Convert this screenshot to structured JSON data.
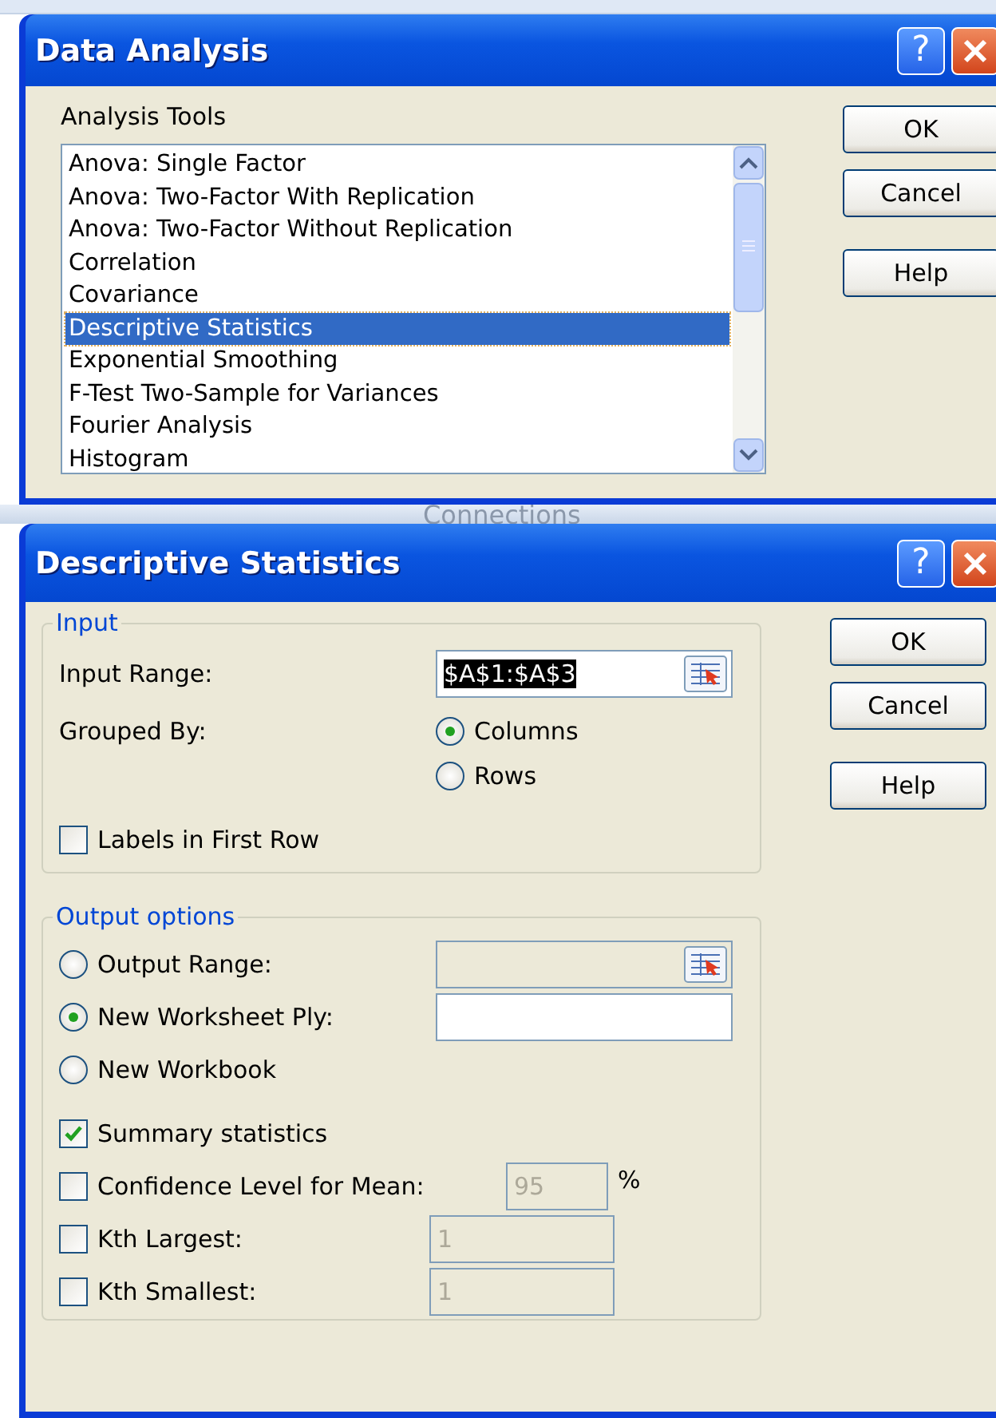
{
  "data_analysis": {
    "title": "Data Analysis",
    "help_glyph": "?",
    "list_label": "Analysis Tools",
    "tools": [
      {
        "label": "Anova: Single Factor",
        "selected": false
      },
      {
        "label": "Anova: Two-Factor With Replication",
        "selected": false
      },
      {
        "label": "Anova: Two-Factor Without Replication",
        "selected": false
      },
      {
        "label": "Correlation",
        "selected": false
      },
      {
        "label": "Covariance",
        "selected": false
      },
      {
        "label": "Descriptive Statistics",
        "selected": true
      },
      {
        "label": "Exponential Smoothing",
        "selected": false
      },
      {
        "label": "F-Test Two-Sample for Variances",
        "selected": false
      },
      {
        "label": "Fourier Analysis",
        "selected": false
      },
      {
        "label": "Histogram",
        "selected": false
      }
    ],
    "buttons": [
      "OK",
      "Cancel",
      "Help"
    ]
  },
  "background": {
    "toolbar_label": "Connections"
  },
  "descriptive_statistics": {
    "title": "Descriptive Statistics",
    "help_glyph": "?",
    "input": {
      "legend": "Input",
      "range_label": "Input Range:",
      "range_value": "$A$1:$A$3",
      "grouped_label": "Grouped By:",
      "grouped_options": [
        {
          "label": "Columns",
          "selected": true
        },
        {
          "label": "Rows",
          "selected": false
        }
      ],
      "labels_first_row": {
        "label": "Labels in First Row",
        "checked": false
      }
    },
    "output": {
      "legend": "Output options",
      "destinations": [
        {
          "label": "Output Range:",
          "selected": false,
          "kind": "range"
        },
        {
          "label": "New Worksheet Ply:",
          "selected": true,
          "kind": "text"
        },
        {
          "label": "New Workbook",
          "selected": false,
          "kind": "none"
        }
      ],
      "options": [
        {
          "label": "Summary statistics",
          "checked": true,
          "kind": "plain"
        },
        {
          "label": "Confidence Level for Mean:",
          "checked": false,
          "kind": "percent",
          "value": "95",
          "unit": "%"
        },
        {
          "label": "Kth Largest:",
          "checked": false,
          "kind": "number",
          "value": "1"
        },
        {
          "label": "Kth Smallest:",
          "checked": false,
          "kind": "number",
          "value": "1"
        }
      ]
    },
    "buttons": [
      "OK",
      "Cancel",
      "Help"
    ]
  }
}
